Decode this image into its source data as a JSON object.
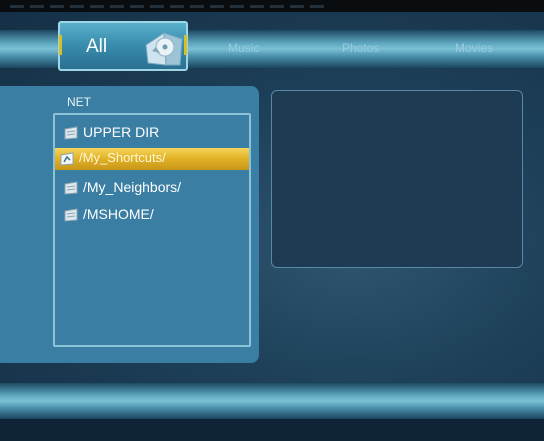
{
  "tabs": {
    "active_label": "All",
    "music_label": "Music",
    "photos_label": "Photos",
    "movies_label": "Movies"
  },
  "browser": {
    "title": "NET",
    "items": [
      {
        "label": "UPPER DIR",
        "icon": "folder-up-icon",
        "selected": false
      },
      {
        "label": "/My_Shortcuts/",
        "icon": "shortcut-folder-icon",
        "selected": true
      },
      {
        "label": "/My_Neighbors/",
        "icon": "folder-icon",
        "selected": false
      },
      {
        "label": "/MSHOME/",
        "icon": "folder-icon",
        "selected": false
      }
    ]
  },
  "colors": {
    "selection": "#e0b125",
    "panel": "#3a7fa3",
    "background": "#1d3f58",
    "accent_cap": "#d8c020"
  }
}
